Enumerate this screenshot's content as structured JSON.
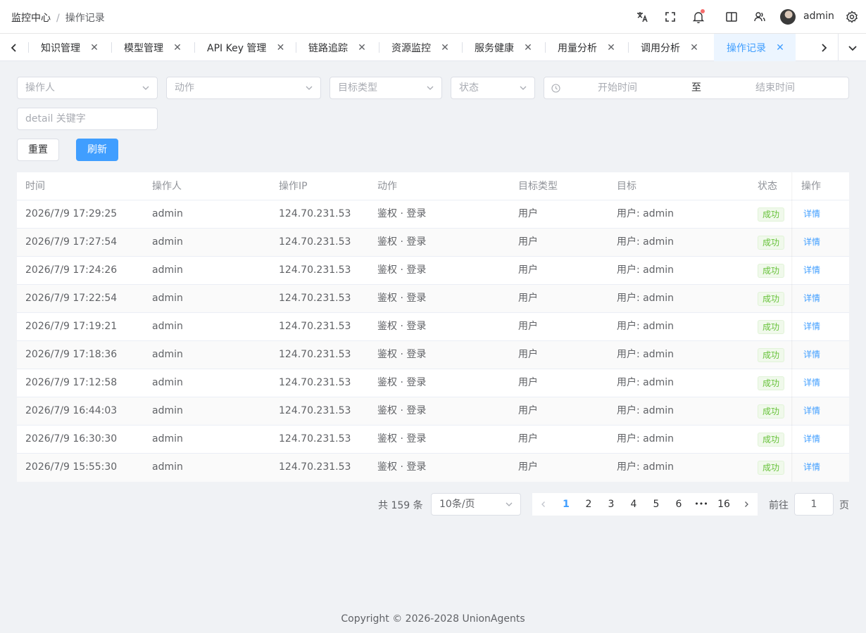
{
  "header": {
    "breadcrumb": [
      "监控中心",
      "操作记录"
    ],
    "username": "admin"
  },
  "tabs": [
    {
      "label": "知识管理"
    },
    {
      "label": "模型管理"
    },
    {
      "label": "API Key 管理"
    },
    {
      "label": "链路追踪"
    },
    {
      "label": "资源监控"
    },
    {
      "label": "服务健康"
    },
    {
      "label": "用量分析"
    },
    {
      "label": "调用分析"
    },
    {
      "label": "操作记录",
      "active": true
    }
  ],
  "filters": {
    "operator_placeholder": "操作人",
    "action_placeholder": "动作",
    "target_type_placeholder": "目标类型",
    "status_placeholder": "状态",
    "start_placeholder": "开始时间",
    "range_separator": "至",
    "end_placeholder": "结束时间",
    "detail_placeholder": "detail 关键字",
    "reset_label": "重置",
    "refresh_label": "刷新"
  },
  "table": {
    "columns": [
      "时间",
      "操作人",
      "操作IP",
      "动作",
      "目标类型",
      "目标",
      "状态",
      "操作"
    ],
    "rows": [
      {
        "time": "2026/7/9 17:29:25",
        "operator": "admin",
        "ip": "124.70.231.53",
        "action": "鉴权 · 登录",
        "target_type": "用户",
        "target": "用户: admin",
        "status": "成功",
        "op": "详情"
      },
      {
        "time": "2026/7/9 17:27:54",
        "operator": "admin",
        "ip": "124.70.231.53",
        "action": "鉴权 · 登录",
        "target_type": "用户",
        "target": "用户: admin",
        "status": "成功",
        "op": "详情"
      },
      {
        "time": "2026/7/9 17:24:26",
        "operator": "admin",
        "ip": "124.70.231.53",
        "action": "鉴权 · 登录",
        "target_type": "用户",
        "target": "用户: admin",
        "status": "成功",
        "op": "详情"
      },
      {
        "time": "2026/7/9 17:22:54",
        "operator": "admin",
        "ip": "124.70.231.53",
        "action": "鉴权 · 登录",
        "target_type": "用户",
        "target": "用户: admin",
        "status": "成功",
        "op": "详情"
      },
      {
        "time": "2026/7/9 17:19:21",
        "operator": "admin",
        "ip": "124.70.231.53",
        "action": "鉴权 · 登录",
        "target_type": "用户",
        "target": "用户: admin",
        "status": "成功",
        "op": "详情"
      },
      {
        "time": "2026/7/9 17:18:36",
        "operator": "admin",
        "ip": "124.70.231.53",
        "action": "鉴权 · 登录",
        "target_type": "用户",
        "target": "用户: admin",
        "status": "成功",
        "op": "详情"
      },
      {
        "time": "2026/7/9 17:12:58",
        "operator": "admin",
        "ip": "124.70.231.53",
        "action": "鉴权 · 登录",
        "target_type": "用户",
        "target": "用户: admin",
        "status": "成功",
        "op": "详情"
      },
      {
        "time": "2026/7/9 16:44:03",
        "operator": "admin",
        "ip": "124.70.231.53",
        "action": "鉴权 · 登录",
        "target_type": "用户",
        "target": "用户: admin",
        "status": "成功",
        "op": "详情"
      },
      {
        "time": "2026/7/9 16:30:30",
        "operator": "admin",
        "ip": "124.70.231.53",
        "action": "鉴权 · 登录",
        "target_type": "用户",
        "target": "用户: admin",
        "status": "成功",
        "op": "详情"
      },
      {
        "time": "2026/7/9 15:55:30",
        "operator": "admin",
        "ip": "124.70.231.53",
        "action": "鉴权 · 登录",
        "target_type": "用户",
        "target": "用户: admin",
        "status": "成功",
        "op": "详情"
      }
    ]
  },
  "pagination": {
    "total": "共 159 条",
    "page_size": "10条/页",
    "pages": [
      "1",
      "2",
      "3",
      "4",
      "5",
      "6",
      "16"
    ],
    "ellipsis": "•••",
    "current": "1",
    "goto_label": "前往",
    "goto_value": "1",
    "goto_unit": "页"
  },
  "footer": "Copyright © 2026-2028 UnionAgents",
  "colors": {
    "primary": "#409eff",
    "success": "#67c23a",
    "badge_dot": "#f56c6c",
    "page_bg": "#f0f2f5"
  }
}
